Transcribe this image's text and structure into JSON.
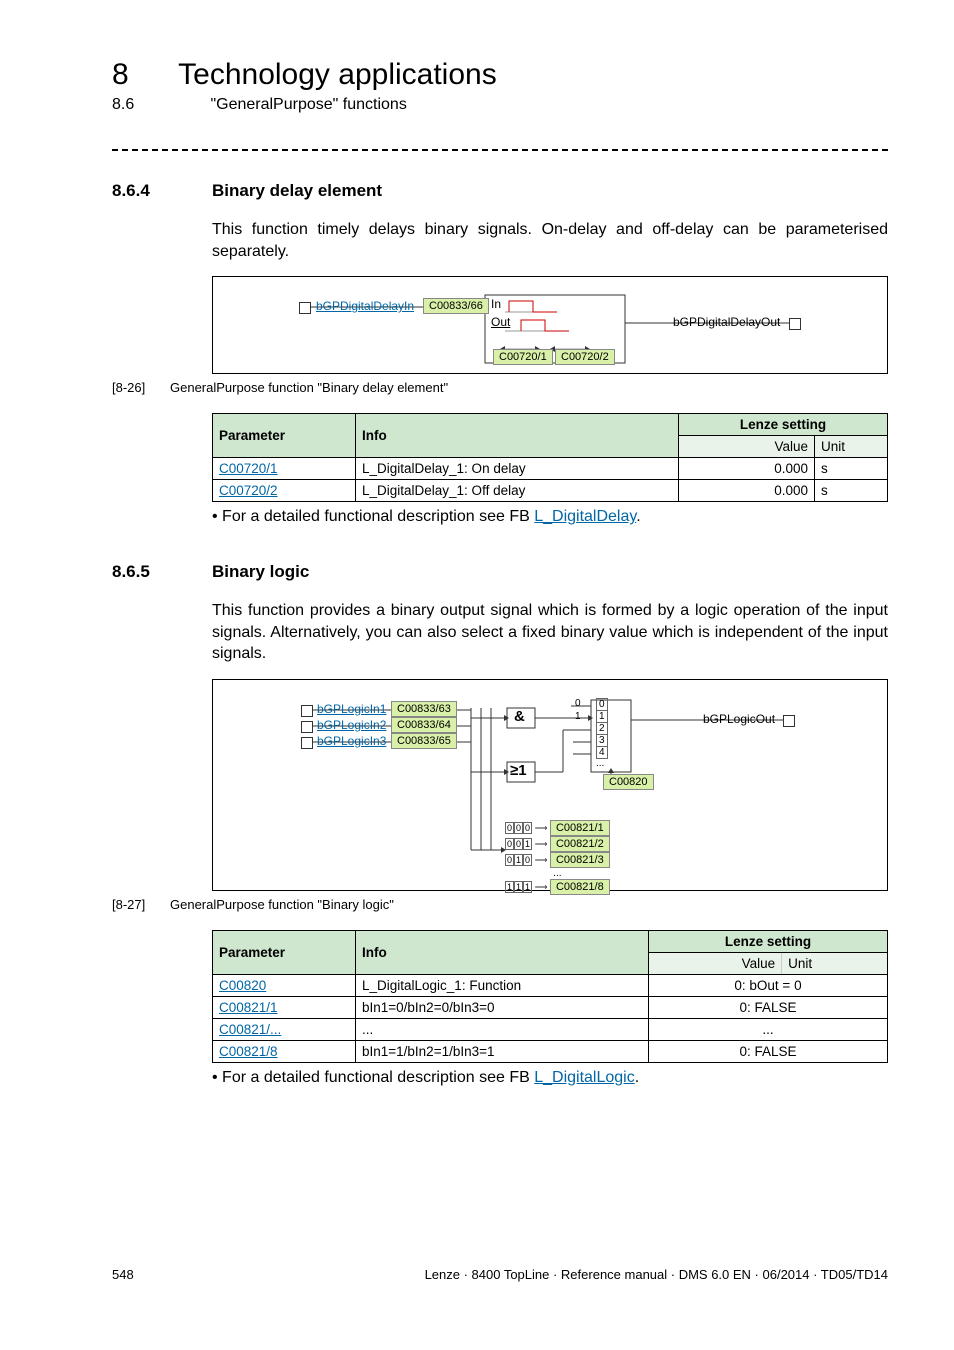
{
  "hdr": {
    "chapter_num": "8",
    "chapter_title": "Technology applications",
    "section_num": "8.6",
    "section_title": "\"GeneralPurpose\" functions"
  },
  "sec1": {
    "num": "8.6.4",
    "title": "Binary delay element",
    "intro": "This function timely delays binary signals. On-delay and off-delay can be parameterised separately.",
    "caption_ref": "[8-26]",
    "caption_text": "GeneralPurpose function \"Binary delay element\"",
    "diagram": {
      "port_in": "bGPDigitalDelayIn",
      "chip_in": "C00833/66",
      "box_lbl_in": "In",
      "box_lbl_out": "Out",
      "chip_on": "C00720/1",
      "chip_off": "C00720/2",
      "port_out": "bGPDigitalDelayOut"
    },
    "table": {
      "col_param": "Parameter",
      "col_info": "Info",
      "col_lenze": "Lenze setting",
      "col_value": "Value",
      "col_unit": "Unit",
      "rows": [
        {
          "p": "C00720/1",
          "info": "L_DigitalDelay_1: On delay",
          "v": "0.000",
          "u": "s"
        },
        {
          "p": "C00720/2",
          "info": "L_DigitalDelay_1: Off delay",
          "v": "0.000",
          "u": "s"
        }
      ]
    },
    "note_pre": " • For a detailed functional description see FB ",
    "note_link": "L_DigitalDelay",
    "note_post": "."
  },
  "sec2": {
    "num": "8.6.5",
    "title": "Binary logic",
    "intro": "This function provides a binary output signal which is formed by a logic operation of the input signals. Alternatively, you can also select a fixed binary value which is independent of the input signals.",
    "caption_ref": "[8-27]",
    "caption_text": "GeneralPurpose function \"Binary logic\"",
    "diagram": {
      "ports": [
        {
          "name": "bGPLogicIn1",
          "chip": "C00833/63"
        },
        {
          "name": "bGPLogicIn2",
          "chip": "C00833/64"
        },
        {
          "name": "bGPLogicIn3",
          "chip": "C00833/65"
        }
      ],
      "and_lbl": "&",
      "or_lbl": "≥1",
      "mux": {
        "sel0": "0",
        "sel1": "1",
        "sel2": "2",
        "sel3": "3",
        "sel4": "4",
        "dots": "..."
      },
      "chip_sel": "C00820",
      "truth_rows": [
        {
          "a": "0",
          "b": "0",
          "c": "0",
          "chip": "C00821/1"
        },
        {
          "a": "0",
          "b": "0",
          "c": "1",
          "chip": "C00821/2"
        },
        {
          "a": "0",
          "b": "1",
          "c": "0",
          "chip": "C00821/3"
        },
        {
          "a": "1",
          "b": "1",
          "c": "1",
          "chip": "C00821/8",
          "dots": "..."
        }
      ],
      "port_out": "bGPLogicOut"
    },
    "table": {
      "col_param": "Parameter",
      "col_info": "Info",
      "col_lenze": "Lenze setting",
      "col_value": "Value",
      "col_unit": "Unit",
      "rows": [
        {
          "p": "C00820",
          "info": "L_DigitalLogic_1: Function",
          "ls": "0: bOut = 0"
        },
        {
          "p": "C00821/1",
          "info": "bIn1=0/bIn2=0/bIn3=0",
          "ls": "0: FALSE"
        },
        {
          "p": "C00821/...",
          "info": "...",
          "ls": "..."
        },
        {
          "p": "C00821/8",
          "info": "bIn1=1/bIn2=1/bIn3=1",
          "ls": "0: FALSE"
        }
      ]
    },
    "note_pre": " • For a detailed functional description see FB ",
    "note_link": "L_DigitalLogic",
    "note_post": "."
  },
  "footer": {
    "page": "548",
    "right": "Lenze · 8400 TopLine · Reference manual · DMS 6.0 EN · 06/2014 · TD05/TD14"
  }
}
